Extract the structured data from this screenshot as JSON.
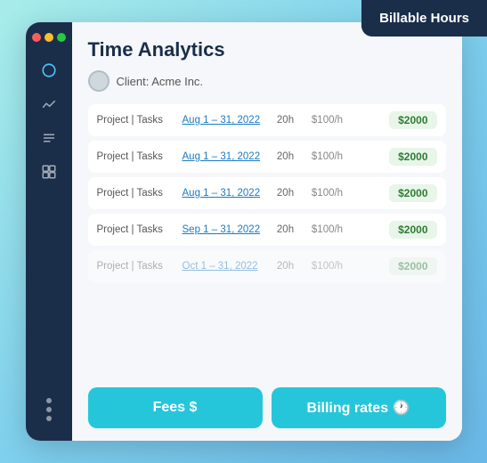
{
  "badge": {
    "label": "Billable Hours"
  },
  "sidebar": {
    "icons": [
      {
        "name": "circle-icon",
        "symbol": "○",
        "active": true
      },
      {
        "name": "chart-icon",
        "symbol": "∿",
        "active": false
      },
      {
        "name": "list-icon",
        "symbol": "≡",
        "active": false
      },
      {
        "name": "grid-icon",
        "symbol": "▦",
        "active": false
      }
    ],
    "dots": [
      1,
      2,
      3
    ]
  },
  "page": {
    "title": "Time Analytics",
    "client_label": "Client: Acme Inc."
  },
  "rows": [
    {
      "project": "Project | Tasks",
      "date": "Aug 1 – 31, 2022",
      "hours": "20h",
      "rate": "$100/h",
      "amount": "$2000",
      "faded": false
    },
    {
      "project": "Project | Tasks",
      "date": "Aug 1 – 31, 2022",
      "hours": "20h",
      "rate": "$100/h",
      "amount": "$2000",
      "faded": false
    },
    {
      "project": "Project | Tasks",
      "date": "Aug 1 – 31, 2022",
      "hours": "20h",
      "rate": "$100/h",
      "amount": "$2000",
      "faded": false
    },
    {
      "project": "Project | Tasks",
      "date": "Sep 1 – 31, 2022",
      "hours": "20h",
      "rate": "$100/h",
      "amount": "$2000",
      "faded": false
    },
    {
      "project": "Project | Tasks",
      "date": "Oct 1 – 31, 2022",
      "hours": "20h",
      "rate": "$100/h",
      "amount": "$2000",
      "faded": true
    }
  ],
  "buttons": {
    "fees_label": "Fees $",
    "billing_label": "Billing rates 🕐"
  }
}
